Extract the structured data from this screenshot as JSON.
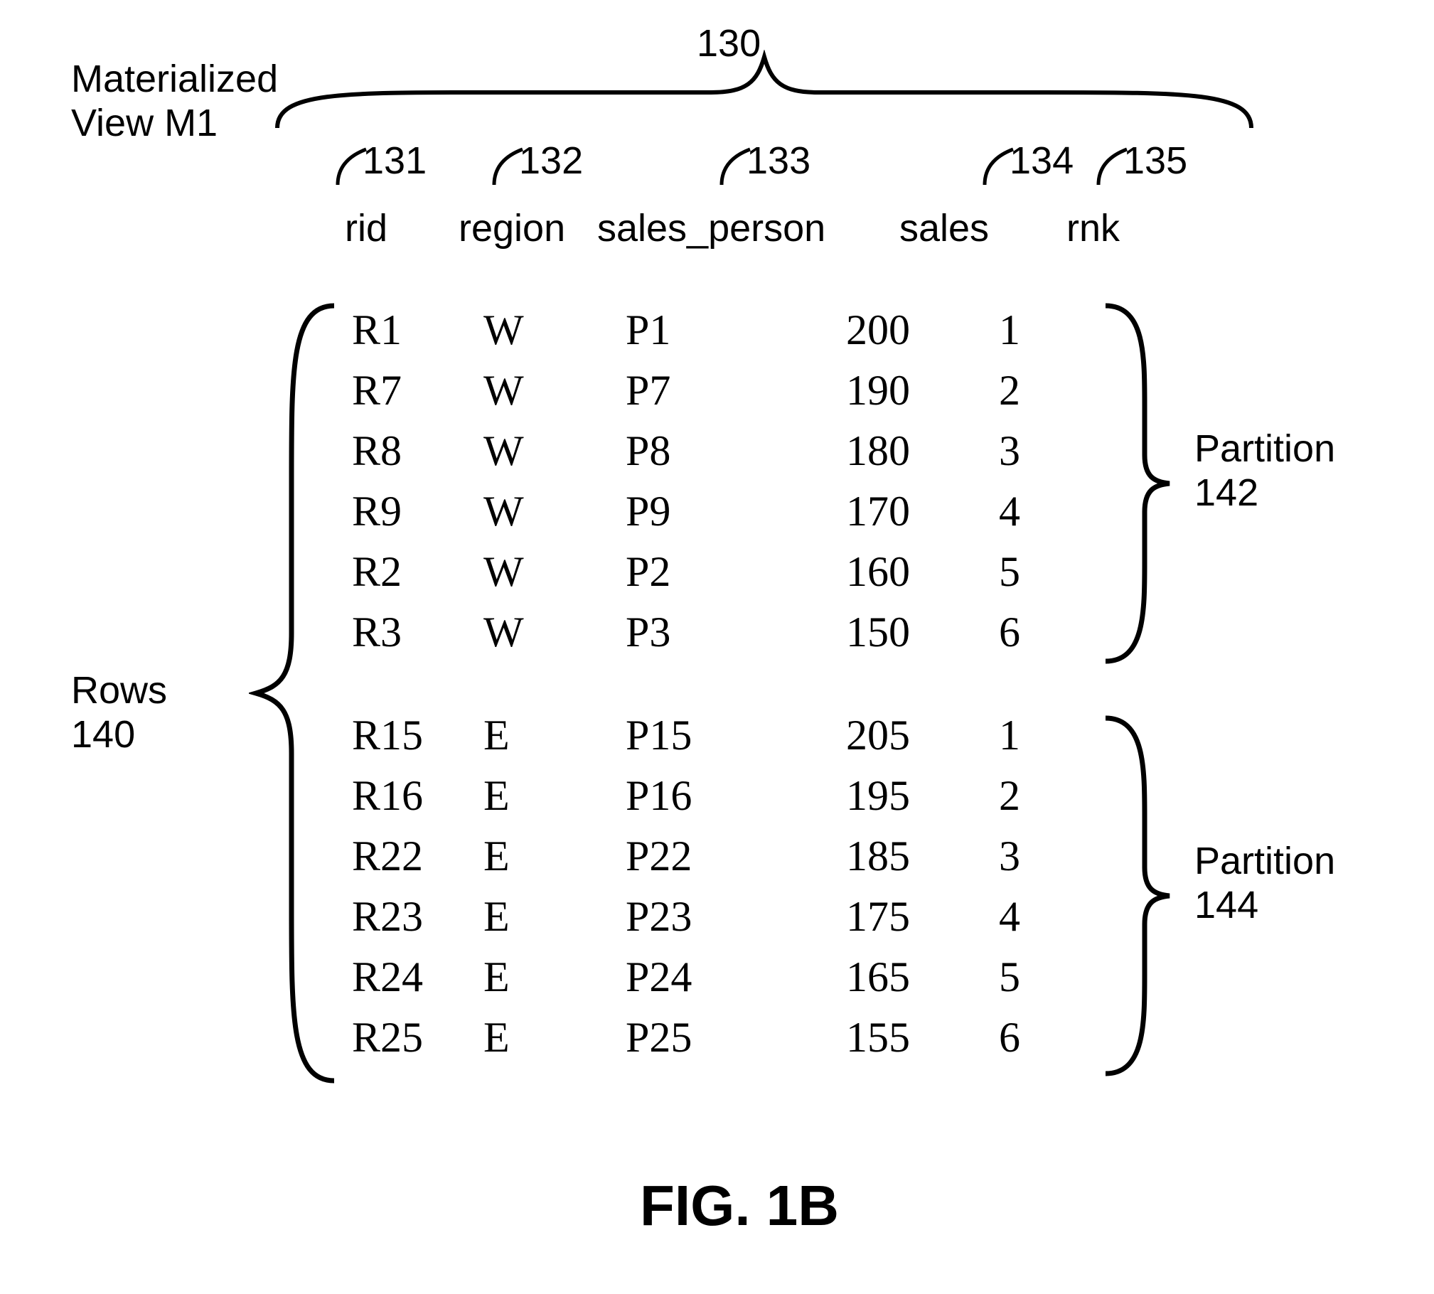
{
  "title_line1": "Materialized",
  "title_line2": "View M1",
  "group_ref": "130",
  "columns": [
    {
      "ref": "131",
      "header": "rid"
    },
    {
      "ref": "132",
      "header": "region"
    },
    {
      "ref": "133",
      "header": "sales_person"
    },
    {
      "ref": "134",
      "header": "sales"
    },
    {
      "ref": "135",
      "header": "rnk"
    }
  ],
  "rows_label_line1": "Rows",
  "rows_label_line2": "140",
  "partition1_label_line1": "Partition",
  "partition1_label_line2": "142",
  "partition2_label_line1": "Partition",
  "partition2_label_line2": "144",
  "data_p1": [
    {
      "rid": "R1",
      "region": "W",
      "sp": "P1",
      "sales": "200",
      "rnk": "1"
    },
    {
      "rid": "R7",
      "region": "W",
      "sp": "P7",
      "sales": "190",
      "rnk": "2"
    },
    {
      "rid": "R8",
      "region": "W",
      "sp": "P8",
      "sales": "180",
      "rnk": "3"
    },
    {
      "rid": "R9",
      "region": "W",
      "sp": "P9",
      "sales": "170",
      "rnk": "4"
    },
    {
      "rid": "R2",
      "region": "W",
      "sp": "P2",
      "sales": "160",
      "rnk": "5"
    },
    {
      "rid": "R3",
      "region": "W",
      "sp": "P3",
      "sales": "150",
      "rnk": "6"
    }
  ],
  "data_p2": [
    {
      "rid": "R15",
      "region": "E",
      "sp": "P15",
      "sales": "205",
      "rnk": "1"
    },
    {
      "rid": "R16",
      "region": "E",
      "sp": "P16",
      "sales": "195",
      "rnk": "2"
    },
    {
      "rid": "R22",
      "region": "E",
      "sp": "P22",
      "sales": "185",
      "rnk": "3"
    },
    {
      "rid": "R23",
      "region": "E",
      "sp": "P23",
      "sales": "175",
      "rnk": "4"
    },
    {
      "rid": "R24",
      "region": "E",
      "sp": "P24",
      "sales": "165",
      "rnk": "5"
    },
    {
      "rid": "R25",
      "region": "E",
      "sp": "P25",
      "sales": "155",
      "rnk": "6"
    }
  ],
  "figure_caption": "FIG. 1B"
}
